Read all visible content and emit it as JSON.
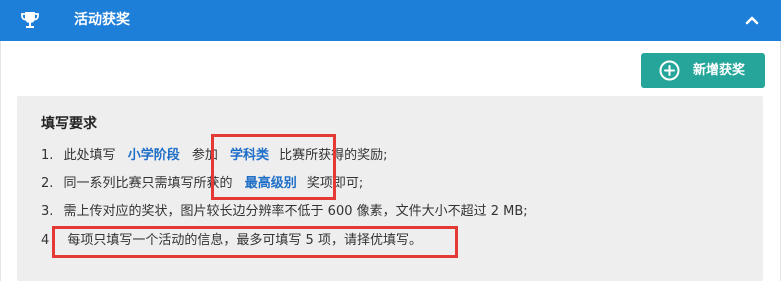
{
  "header": {
    "title": "活动获奖",
    "icon": "trophy-icon",
    "collapse_icon": "chevron-up-icon",
    "bg_color": "#1e7fd8"
  },
  "add_button": {
    "label": "新增获奖",
    "icon": "plus-circle-icon",
    "color": "#26a69a"
  },
  "requirements": {
    "title": "填写要求",
    "items": [
      {
        "num": "1.",
        "pre": "此处填写",
        "hl1": "小学阶段",
        "mid": "参加",
        "hl2": "学科类",
        "post": "比赛所获得的奖励;"
      },
      {
        "num": "2.",
        "pre": "同一系列比赛只需填写所获的",
        "hl1": "最高级别",
        "post": "奖项即可;"
      },
      {
        "num": "3.",
        "text": "需上传对应的奖状，图片较长边分辨率不低于 600 像素，文件大小不超过 2 MB;"
      },
      {
        "num": "4",
        "text": "每项只填写一个活动的信息，最多可填写 5 项，请择优填写。"
      }
    ]
  }
}
